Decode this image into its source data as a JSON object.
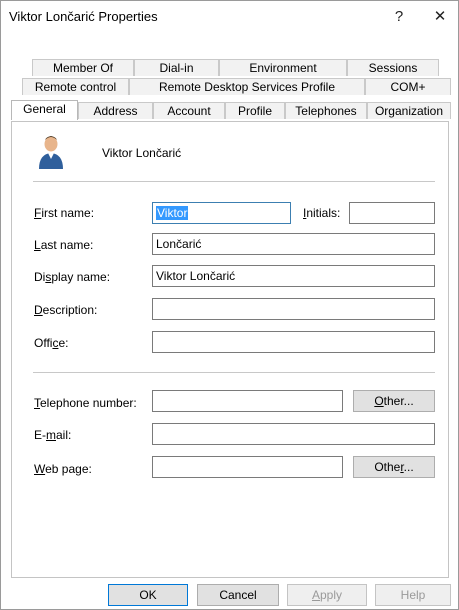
{
  "window": {
    "title": "Viktor Lončarić Properties",
    "help_glyph": "?",
    "close_glyph": "✕"
  },
  "tabs": {
    "row1": [
      "Member Of",
      "Dial-in",
      "Environment",
      "Sessions"
    ],
    "row2": [
      "Remote control",
      "Remote Desktop Services Profile",
      "COM+"
    ],
    "row3": [
      "General",
      "Address",
      "Account",
      "Profile",
      "Telephones",
      "Organization"
    ],
    "active": "General"
  },
  "general": {
    "display_header": "Viktor Lončarić",
    "first_name": {
      "label_pre": "",
      "label_u": "F",
      "label_post": "irst name:",
      "value": "Viktor"
    },
    "initials": {
      "label_pre": "",
      "label_u": "I",
      "label_post": "nitials:",
      "value": ""
    },
    "last_name": {
      "label_pre": "",
      "label_u": "L",
      "label_post": "ast name:",
      "value": "Lončarić"
    },
    "display_name": {
      "label_pre": "Di",
      "label_u": "s",
      "label_post": "play name:",
      "value": "Viktor Lončarić"
    },
    "description": {
      "label_pre": "",
      "label_u": "D",
      "label_post": "escription:",
      "value": ""
    },
    "office": {
      "label_pre": "Offi",
      "label_u": "c",
      "label_post": "e:",
      "value": ""
    },
    "telephone": {
      "label_pre": "",
      "label_u": "T",
      "label_post": "elephone number:",
      "value": ""
    },
    "email": {
      "label_pre": "E-",
      "label_u": "m",
      "label_post": "ail:",
      "value": ""
    },
    "webpage": {
      "label_pre": "",
      "label_u": "W",
      "label_post": "eb page:",
      "value": ""
    },
    "other_phone": {
      "pre": "",
      "u": "O",
      "post": "ther..."
    },
    "other_web": {
      "pre": "Othe",
      "u": "r",
      "post": "..."
    }
  },
  "buttons": {
    "ok": "OK",
    "cancel": "Cancel",
    "apply_pre": "",
    "apply_u": "A",
    "apply_post": "pply",
    "help": "Help"
  },
  "colors": {
    "selection": "#3399ff",
    "focus_border": "#3c7fb1",
    "avatar_shirt": "#2f5f9c",
    "avatar_skin": "#e8b58c"
  },
  "icons": {
    "avatar": "user-icon"
  }
}
